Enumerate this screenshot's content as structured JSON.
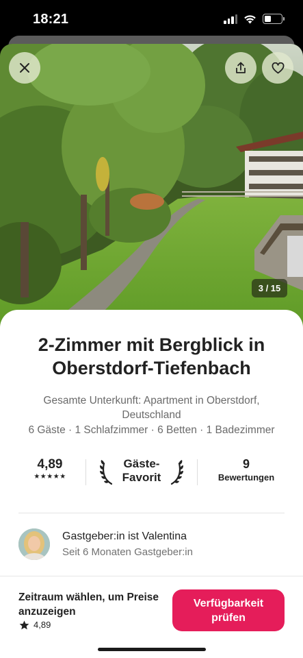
{
  "status_bar": {
    "time": "18:21"
  },
  "photo": {
    "counter": "3 / 15"
  },
  "listing": {
    "title": "2-Zimmer mit Bergblick in Oberstdorf-Tiefenbach",
    "subtitle": "Gesamte Unterkunft: Apartment in Oberstdorf, Deutschland",
    "details": "6 Gäste · 1 Schlafzimmer · 6 Betten · 1 Badezimmer"
  },
  "stats": {
    "rating": "4,89",
    "stars": "★★★★★",
    "favorite_line1": "Gäste-",
    "favorite_line2": "Favorit",
    "reviews_count": "9",
    "reviews_label": "Bewertungen"
  },
  "host": {
    "title": "Gastgeber:in ist Valentina",
    "since": "Seit 6 Monaten Gastgeber:in"
  },
  "footer": {
    "note": "Zeitraum wählen, um Preise anzuzeigen",
    "rating": "4,89",
    "cta_line1": "Verfügbarkeit",
    "cta_line2": "prüfen"
  },
  "colors": {
    "accent": "#e51d5a",
    "text": "#222222",
    "muted": "#6a6a6a"
  },
  "icons": [
    "close-icon",
    "share-icon",
    "heart-icon",
    "laurel-icon",
    "star-icon",
    "signal-icon",
    "wifi-icon",
    "battery-icon"
  ]
}
